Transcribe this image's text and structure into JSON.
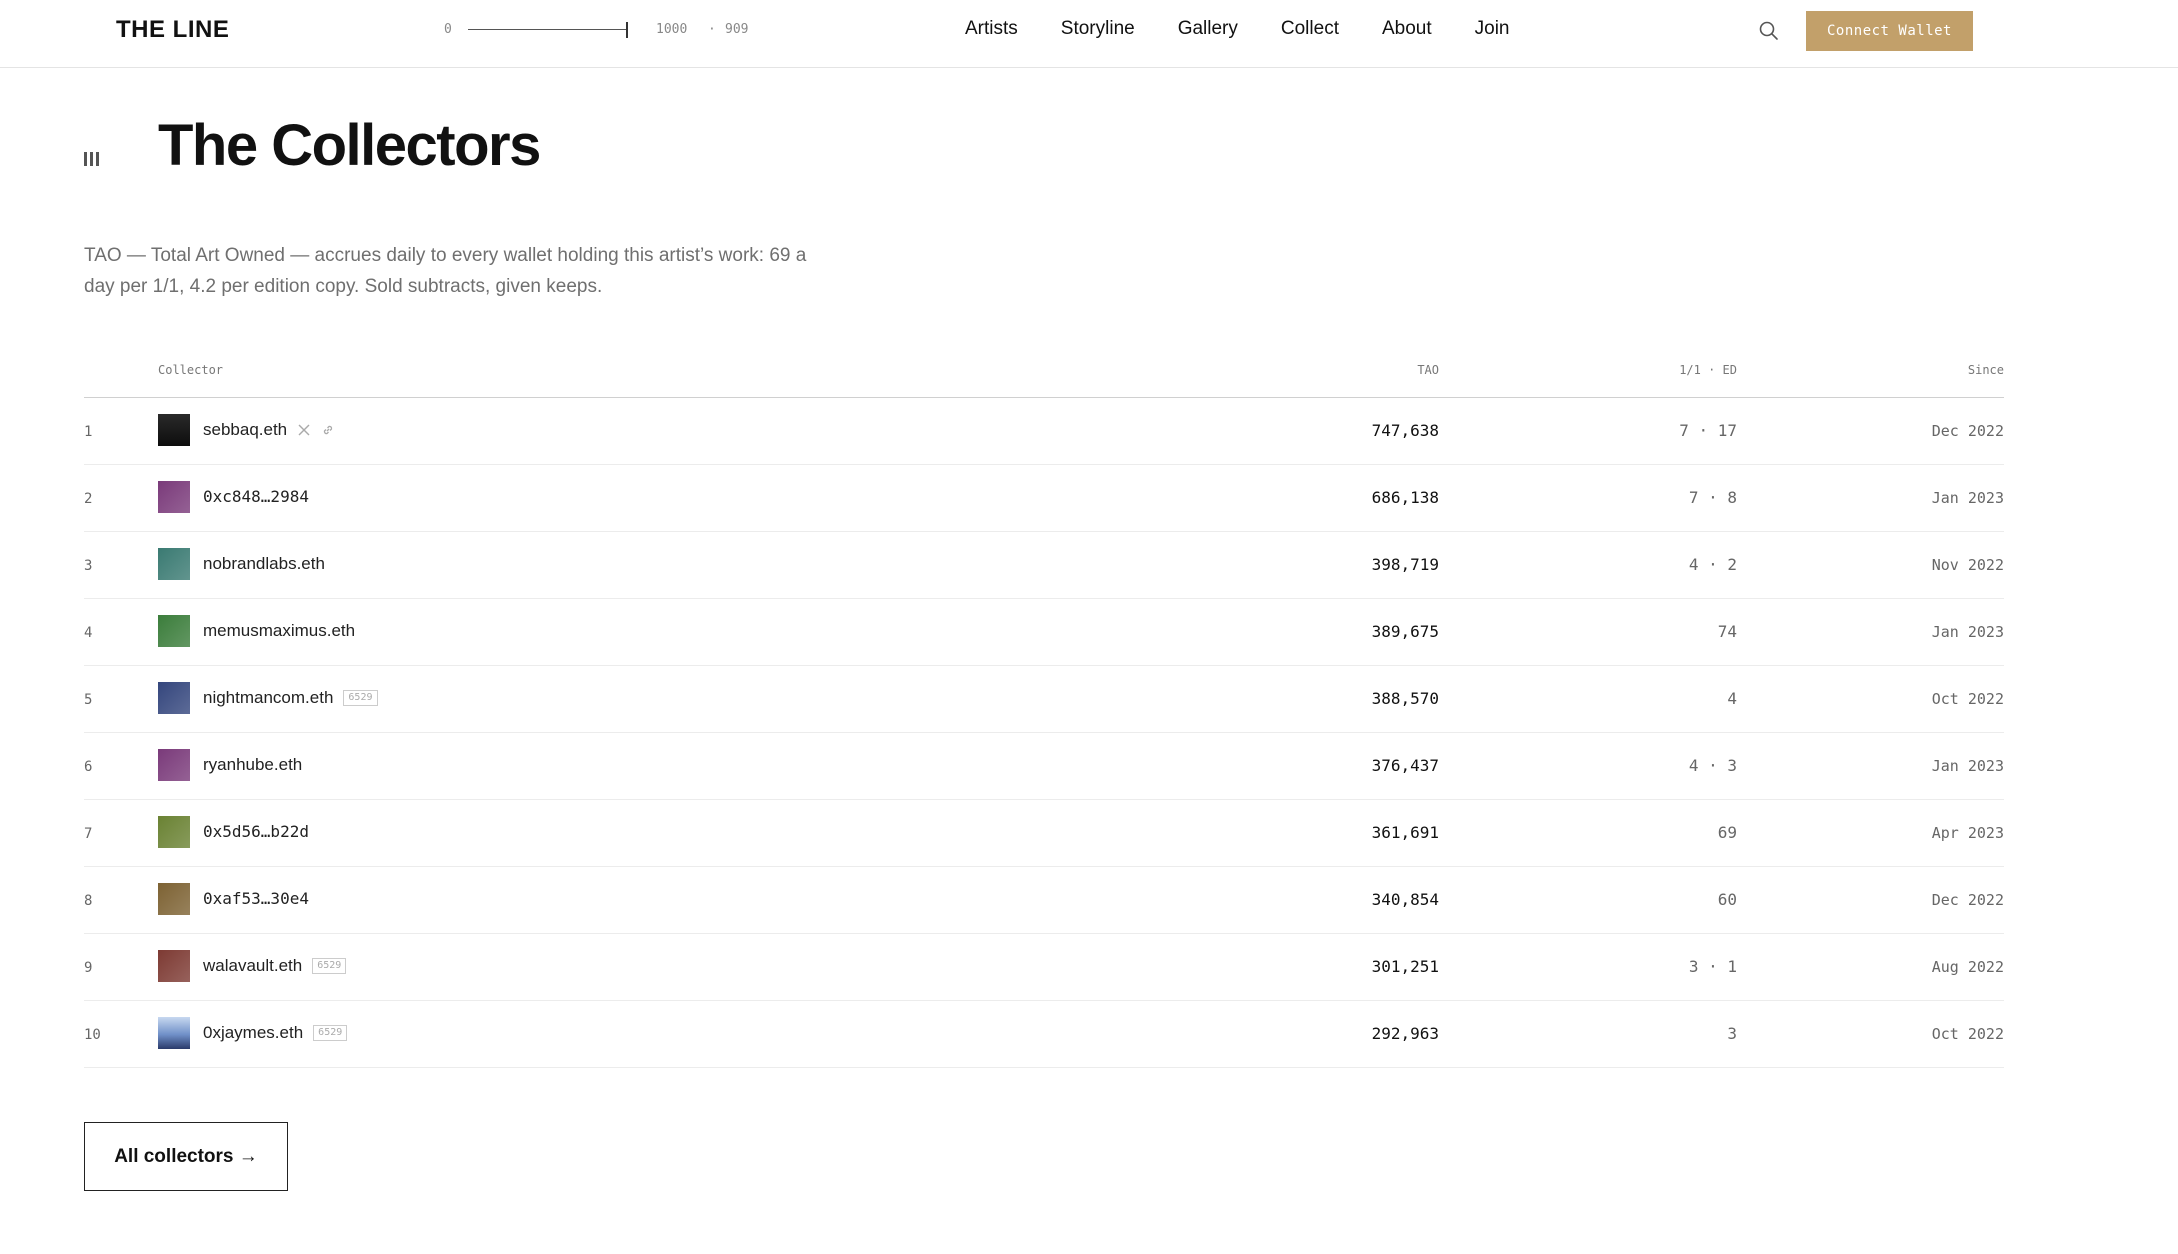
{
  "header": {
    "logo": "THE LINE",
    "slider": {
      "min_label": "0",
      "max_label": "1000",
      "separator": "·",
      "value_label": "909",
      "value": 909,
      "max": 1000
    },
    "nav": [
      "Artists",
      "Storyline",
      "Gallery",
      "Collect",
      "About",
      "Join"
    ],
    "connect_label": "Connect Wallet",
    "accent_color": "#c2a06a"
  },
  "page": {
    "title": "The Collectors",
    "description": "TAO — Total Art Owned — accrues daily to every wallet holding this artist’s work: 69 a day per 1/1, 4.2 per edition copy. Sold subtracts, given keeps."
  },
  "table": {
    "headers": {
      "collector": "Collector",
      "tao": "TAO",
      "ed": "1/1 · ED",
      "since": "Since"
    },
    "rows": [
      {
        "rank": "1",
        "name": "sebbaq.eth",
        "mono": false,
        "badge": "",
        "social": true,
        "tao": "747,638",
        "ed": "7 · 17",
        "since": "Dec 2022",
        "avatar_color": "#1a1a1a"
      },
      {
        "rank": "2",
        "name": "0xc848…2984",
        "mono": true,
        "badge": "",
        "social": false,
        "tao": "686,138",
        "ed": "7 · 8",
        "since": "Jan 2023",
        "avatar_color": "#7a3a7a"
      },
      {
        "rank": "3",
        "name": "nobrandlabs.eth",
        "mono": false,
        "badge": "",
        "social": false,
        "tao": "398,719",
        "ed": "4 · 2",
        "since": "Nov 2022",
        "avatar_color": "#3a7a72"
      },
      {
        "rank": "4",
        "name": "memusmaximus.eth",
        "mono": false,
        "badge": "",
        "social": false,
        "tao": "389,675",
        "ed": "74",
        "since": "Jan 2023",
        "avatar_color": "#3b7d3b"
      },
      {
        "rank": "5",
        "name": "nightmancom.eth",
        "mono": false,
        "badge": "6529",
        "social": false,
        "tao": "388,570",
        "ed": "4",
        "since": "Oct 2022",
        "avatar_color": "#34467d"
      },
      {
        "rank": "6",
        "name": "ryanhube.eth",
        "mono": false,
        "badge": "",
        "social": false,
        "tao": "376,437",
        "ed": "4 · 3",
        "since": "Jan 2023",
        "avatar_color": "#7a3a7a"
      },
      {
        "rank": "7",
        "name": "0x5d56…b22d",
        "mono": true,
        "badge": "",
        "social": false,
        "tao": "361,691",
        "ed": "69",
        "since": "Apr 2023",
        "avatar_color": "#6a8233"
      },
      {
        "rank": "8",
        "name": "0xaf53…30e4",
        "mono": true,
        "badge": "",
        "social": false,
        "tao": "340,854",
        "ed": "60",
        "since": "Dec 2022",
        "avatar_color": "#7d6233"
      },
      {
        "rank": "9",
        "name": "walavault.eth",
        "mono": false,
        "badge": "6529",
        "social": false,
        "tao": "301,251",
        "ed": "3 · 1",
        "since": "Aug 2022",
        "avatar_color": "#7d3a33"
      },
      {
        "rank": "10",
        "name": "0xjaymes.eth",
        "mono": false,
        "badge": "6529",
        "social": false,
        "tao": "292,963",
        "ed": "3",
        "since": "Oct 2022",
        "avatar_color": "#6a8ad0"
      }
    ]
  },
  "footer": {
    "all_collectors_label": "All collectors →"
  },
  "icons": {
    "search": "search-icon",
    "menu": "menu-icon",
    "x": "x-icon",
    "link": "link-icon"
  }
}
